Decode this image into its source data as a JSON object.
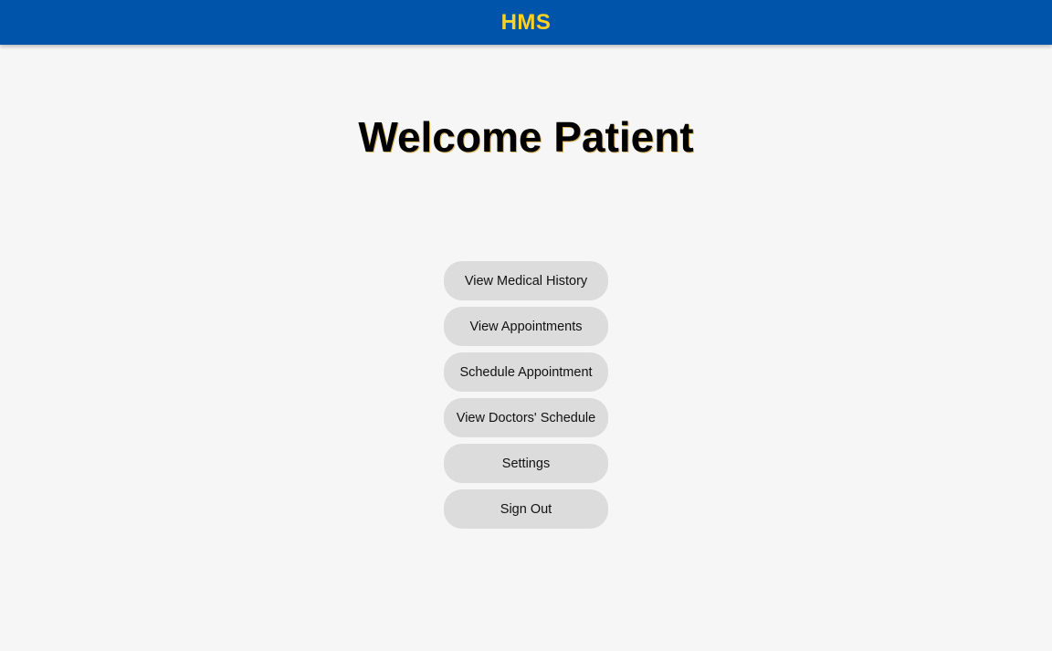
{
  "header": {
    "app_title": "HMS"
  },
  "main": {
    "title": "Welcome Patient",
    "menu": [
      {
        "label": "View Medical History"
      },
      {
        "label": "View Appointments"
      },
      {
        "label": "Schedule Appointment"
      },
      {
        "label": "View Doctors' Schedule"
      },
      {
        "label": "Settings"
      },
      {
        "label": "Sign Out"
      }
    ]
  },
  "colors": {
    "header_background": "#0055aa",
    "header_title": "#ffd21f",
    "page_background": "#f7f6f6",
    "button_background": "#dcdcdc"
  }
}
